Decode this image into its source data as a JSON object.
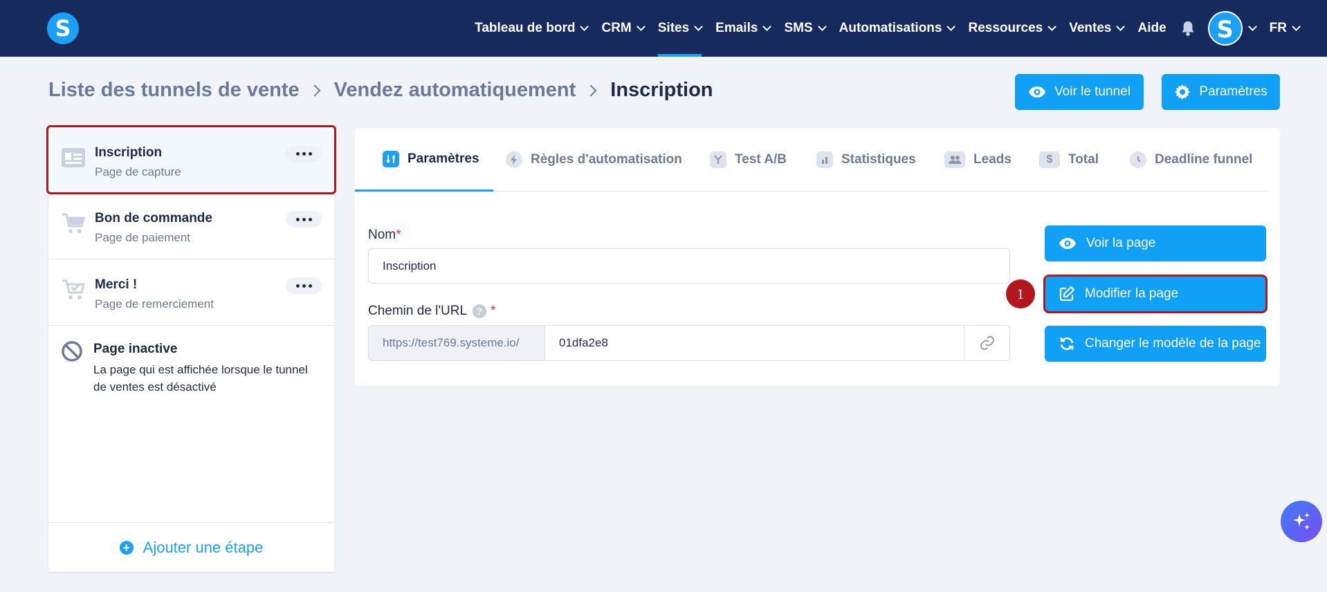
{
  "nav": {
    "logo_letter": "S",
    "items": [
      {
        "label": "Tableau de bord",
        "has_menu": true,
        "active": false
      },
      {
        "label": "CRM",
        "has_menu": true,
        "active": false
      },
      {
        "label": "Sites",
        "has_menu": true,
        "active": true
      },
      {
        "label": "Emails",
        "has_menu": true,
        "active": false
      },
      {
        "label": "SMS",
        "has_menu": true,
        "active": false
      },
      {
        "label": "Automatisations",
        "has_menu": true,
        "active": false
      },
      {
        "label": "Ressources",
        "has_menu": true,
        "active": false
      },
      {
        "label": "Ventes",
        "has_menu": true,
        "active": false
      },
      {
        "label": "Aide",
        "has_menu": false,
        "active": false
      }
    ],
    "avatar_letter": "S",
    "language": "FR"
  },
  "breadcrumb": {
    "items": [
      "Liste des tunnels de vente",
      "Vendez automatiquement"
    ],
    "current": "Inscription"
  },
  "header_buttons": {
    "view_funnel": "Voir le tunnel",
    "settings": "Paramètres"
  },
  "sidebar": {
    "steps": [
      {
        "title": "Inscription",
        "subtitle": "Page de capture",
        "icon": "capture-page-icon",
        "selected": true
      },
      {
        "title": "Bon de commande",
        "subtitle": "Page de paiement",
        "icon": "cart-icon",
        "selected": false
      },
      {
        "title": "Merci !",
        "subtitle": "Page de remerciement",
        "icon": "cart-check-icon",
        "selected": false
      }
    ],
    "inactive": {
      "title": "Page inactive",
      "description": "La page qui est affichée lorsque le tunnel de ventes est désactivé"
    },
    "add_step": "Ajouter une étape"
  },
  "tabs": [
    {
      "label": "Paramètres",
      "icon": "sliders-icon",
      "active": true
    },
    {
      "label": "Règles d'automatisation",
      "icon": "bolt-icon",
      "active": false
    },
    {
      "label": "Test A/B",
      "icon": "split-icon",
      "active": false
    },
    {
      "label": "Statistiques",
      "icon": "bar-chart-icon",
      "active": false
    },
    {
      "label": "Leads",
      "icon": "users-icon",
      "active": false
    },
    {
      "label": "Total",
      "icon": "dollar-icon",
      "active": false
    },
    {
      "label": "Deadline funnel",
      "icon": "clock-icon",
      "active": false
    }
  ],
  "form": {
    "name_label": "Nom",
    "name_value": "Inscription",
    "url_label": "Chemin de l'URL",
    "help_glyph": "?",
    "required_mark": "*",
    "url_prefix": "https://test769.systeme.io/",
    "url_path": "01dfa2e8"
  },
  "page_actions": {
    "view": "Voir la page",
    "edit": "Modifier la page",
    "change_template": "Changer le modèle de la page"
  },
  "annotation": {
    "badge": "1"
  },
  "colors": {
    "nav_bg": "#172a5e",
    "accent": "#10a0f5",
    "highlight": "#b3161d"
  }
}
